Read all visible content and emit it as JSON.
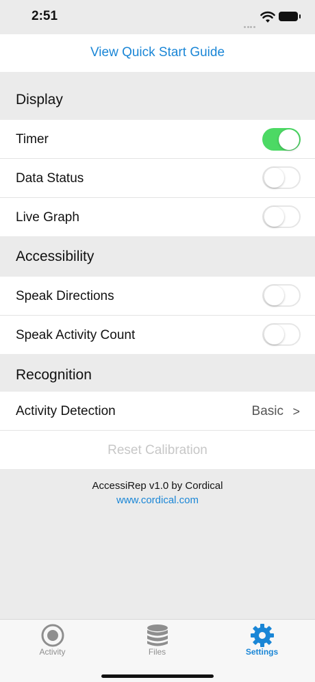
{
  "status": {
    "time": "2:51"
  },
  "quick_start": {
    "label": "View Quick Start Guide"
  },
  "sections": {
    "display": {
      "title": "Display",
      "items": [
        {
          "label": "Timer",
          "on": true
        },
        {
          "label": "Data Status",
          "on": false
        },
        {
          "label": "Live Graph",
          "on": false
        }
      ]
    },
    "accessibility": {
      "title": "Accessibility",
      "items": [
        {
          "label": "Speak Directions",
          "on": false
        },
        {
          "label": "Speak Activity Count",
          "on": false
        }
      ]
    },
    "recognition": {
      "title": "Recognition",
      "activity_detection": {
        "label": "Activity Detection",
        "value": "Basic",
        "chevron": ">"
      },
      "reset": {
        "label": "Reset Calibration"
      }
    }
  },
  "footer": {
    "version": "AccessiRep v1.0 by Cordical",
    "link": "www.cordical.com"
  },
  "tabs": [
    {
      "label": "Activity",
      "icon": "record-icon",
      "active": false
    },
    {
      "label": "Files",
      "icon": "database-icon",
      "active": false
    },
    {
      "label": "Settings",
      "icon": "gear-icon",
      "active": true
    }
  ],
  "colors": {
    "accent": "#1a86d6",
    "toggle_on": "#4cd964",
    "background": "#ebebeb"
  }
}
